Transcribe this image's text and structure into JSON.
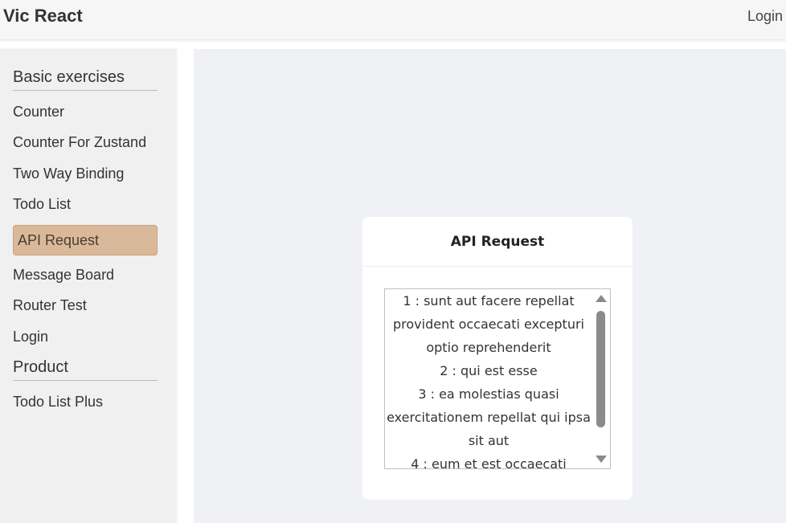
{
  "header": {
    "brand": "Vic React",
    "login": "Login"
  },
  "sidebar": {
    "sections": [
      {
        "title": "Basic exercises",
        "items": [
          {
            "label": "Counter"
          },
          {
            "label": "Counter For Zustand"
          },
          {
            "label": "Two Way Binding"
          },
          {
            "label": "Todo List"
          },
          {
            "label": "API Request",
            "active": true
          },
          {
            "label": "Message Board"
          },
          {
            "label": "Router Test"
          },
          {
            "label": "Login"
          }
        ]
      },
      {
        "title": "Product",
        "items": [
          {
            "label": "Todo List Plus"
          }
        ]
      }
    ]
  },
  "main": {
    "card_title": "API Request",
    "list": [
      "1 : sunt aut facere repellat provident occaecati excepturi optio reprehenderit",
      "2 : qui est esse",
      "3 : ea molestias quasi exercitationem repellat qui ipsa sit aut",
      "4 : eum et est occaecati"
    ]
  },
  "colors": {
    "active_item_bg": "#d9b99a",
    "main_bg": "#f0f1f4",
    "sidebar_bg": "#f0f0f0"
  }
}
